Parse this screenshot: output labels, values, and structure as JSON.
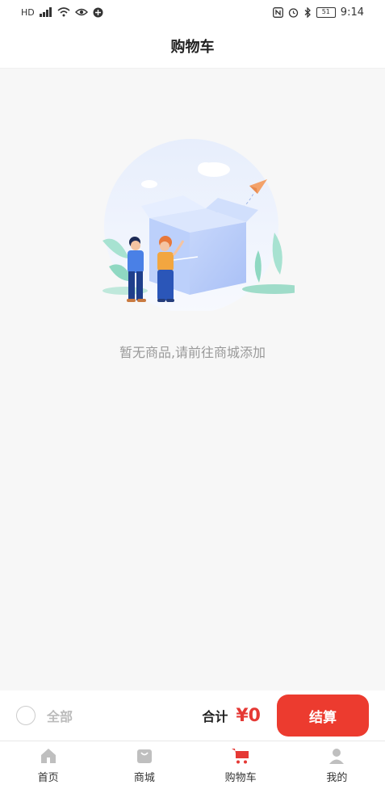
{
  "status_bar": {
    "left_icons": [
      "hd-icon",
      "signal-icon",
      "wifi-icon",
      "eye-icon",
      "app-icon"
    ],
    "right_icons": [
      "nfc-icon",
      "alarm-icon",
      "bluetooth-icon"
    ],
    "battery": "51",
    "time": "9:14"
  },
  "header": {
    "title": "购物车"
  },
  "empty_state": {
    "message": "暂无商品,请前往商城添加"
  },
  "checkout": {
    "select_all_label": "全部",
    "total_label": "合计",
    "total_value": "¥0",
    "pay_label": "结算",
    "accent_color": "#ec3b2f"
  },
  "tabs": [
    {
      "label": "首页",
      "icon": "home-icon"
    },
    {
      "label": "商城",
      "icon": "shopping-bag-icon"
    },
    {
      "label": "购物车",
      "icon": "cart-icon",
      "active": true,
      "color": "#e53935"
    },
    {
      "label": "我的",
      "icon": "profile-icon"
    }
  ]
}
